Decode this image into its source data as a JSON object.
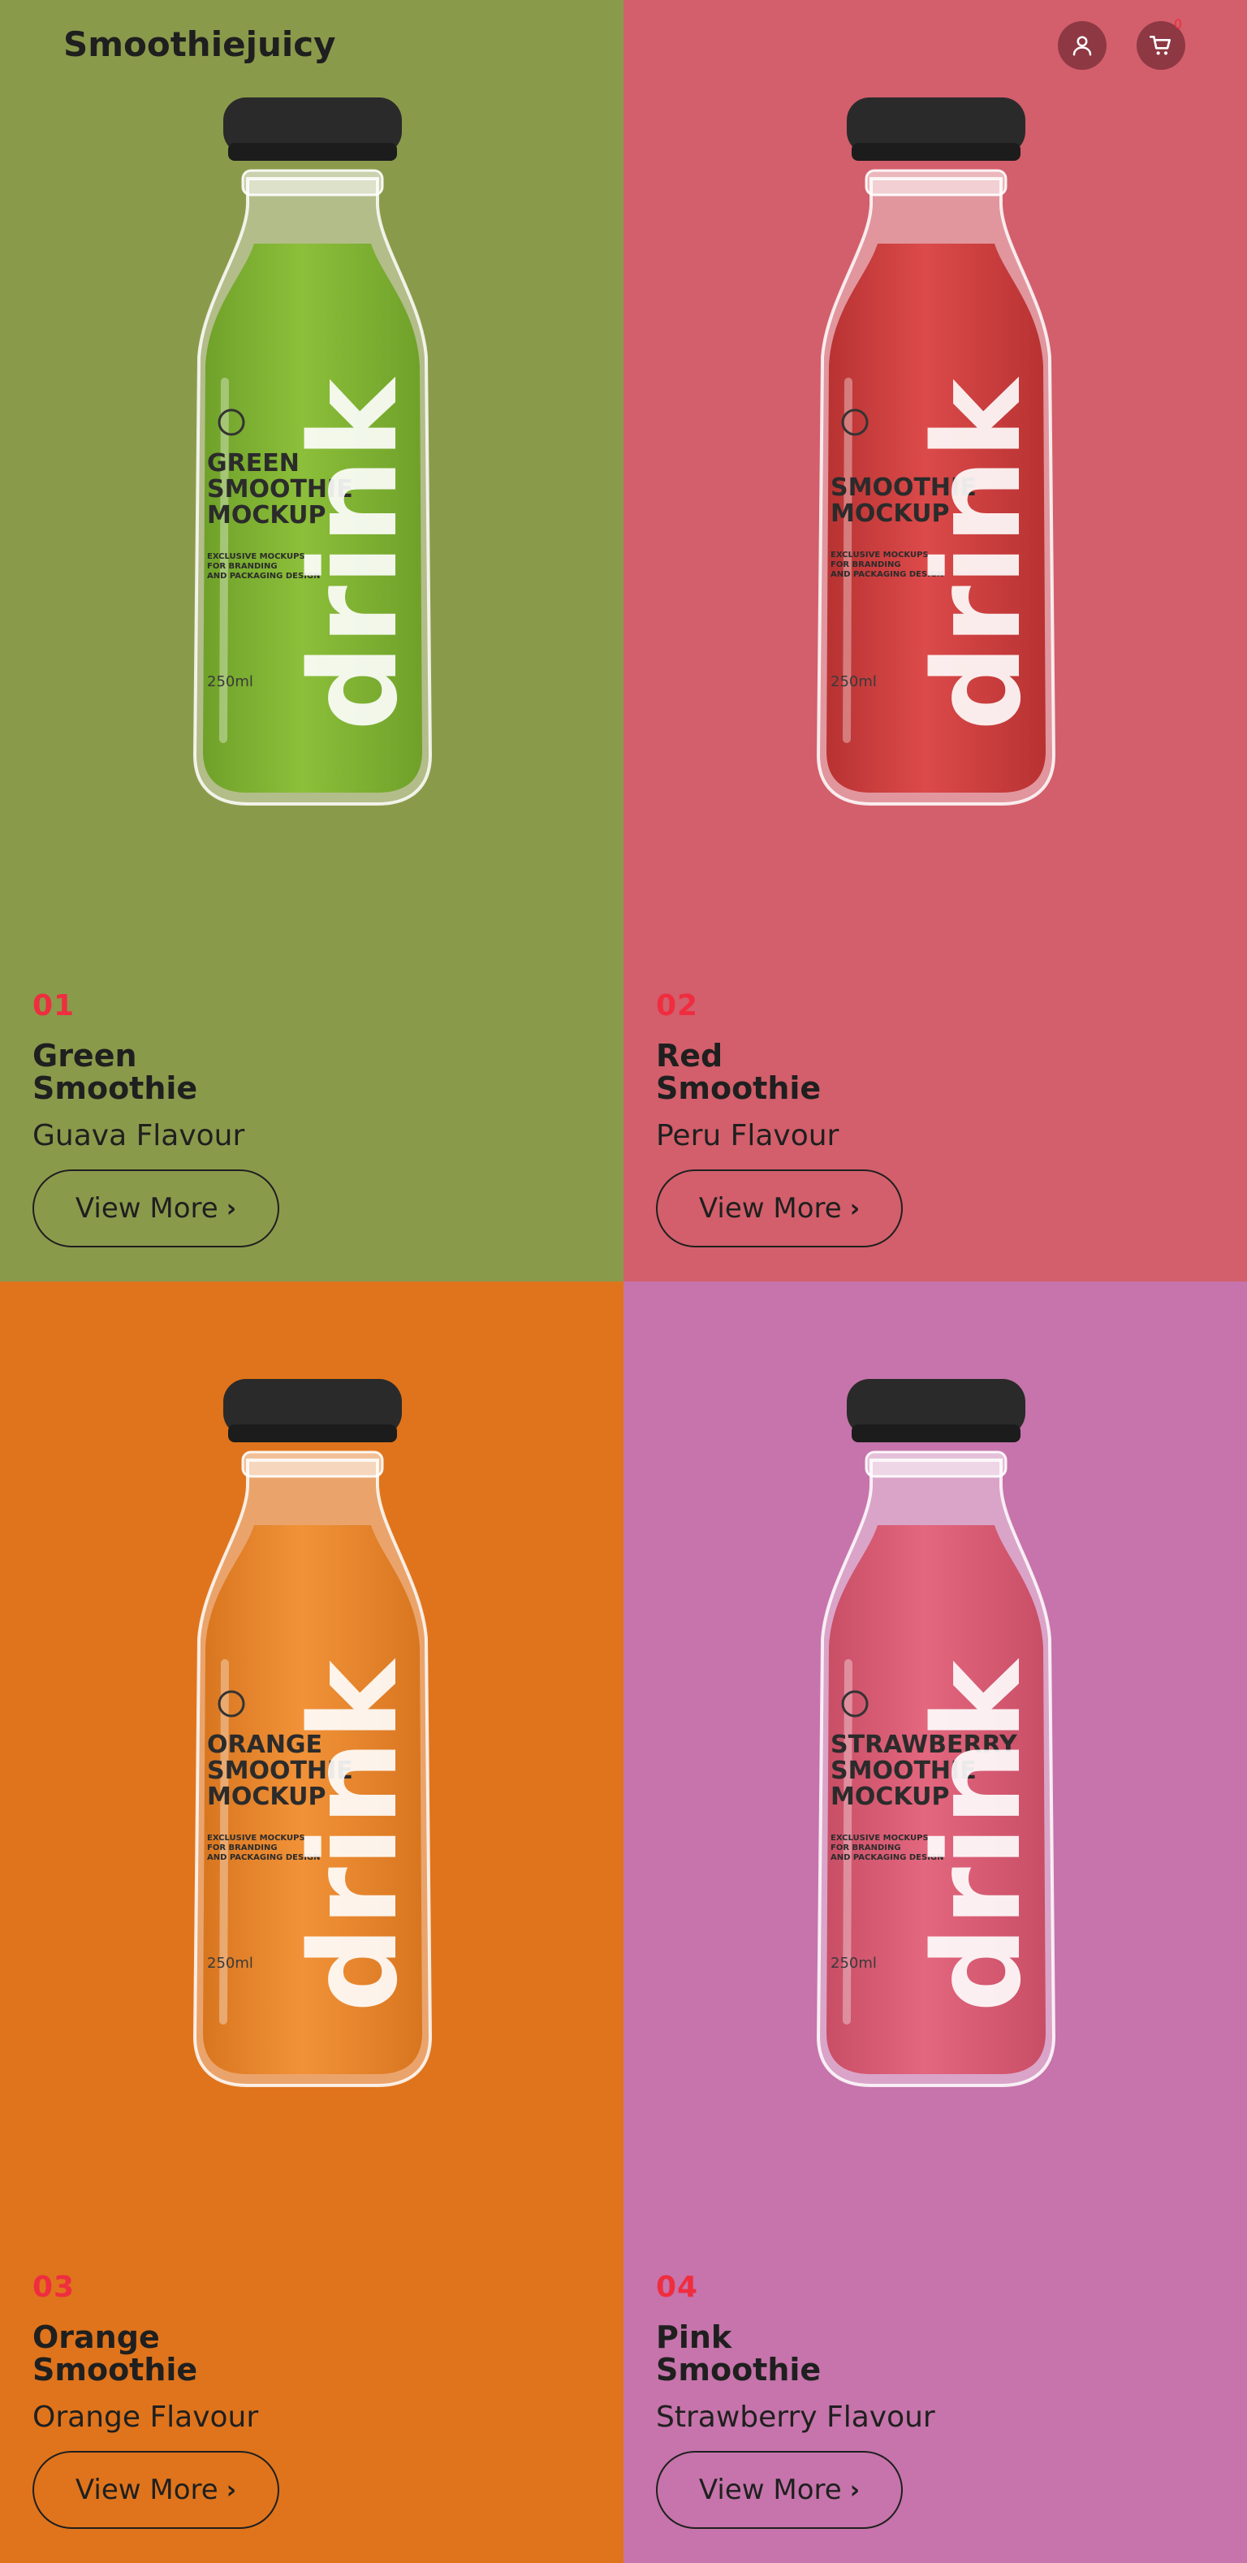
{
  "header": {
    "brand": "Smoothiejuicy",
    "user_icon": "user-icon",
    "cart_icon": "cart-icon",
    "cart_count": "0"
  },
  "products": [
    {
      "number": "01",
      "name_line1": "Green",
      "name_line2": "Smoothie",
      "flavour": "Guava Flavour",
      "button": "View More",
      "bg_color": "#8a9a4b",
      "juice_color": "#8cbf3a",
      "juice_dark": "#6fa12a",
      "label_lines": [
        "GREEN",
        "SMOOTHIE",
        "MOCKUP"
      ],
      "label_small": [
        "EXCLUSIVE MOCKUPS",
        "FOR BRANDING",
        "AND PACKAGING DESIGN"
      ],
      "volume": "250ml",
      "drink": "drink"
    },
    {
      "number": "02",
      "name_line1": "Red",
      "name_line2": "Smoothie",
      "flavour": "Peru Flavour",
      "button": "View More",
      "bg_color": "#d25f6b",
      "juice_color": "#dc4a4a",
      "juice_dark": "#b83232",
      "label_lines": [
        "SMOOTHIE",
        "MOCKUP"
      ],
      "label_small": [
        "EXCLUSIVE MOCKUPS",
        "FOR BRANDING",
        "AND PACKAGING DESIGN"
      ],
      "volume": "250ml",
      "drink": "drink"
    },
    {
      "number": "03",
      "name_line1": "Orange",
      "name_line2": "Smoothie",
      "flavour": "Orange Flavour",
      "button": "View More",
      "bg_color": "#df741c",
      "juice_color": "#f19238",
      "juice_dark": "#d87620",
      "label_lines": [
        "ORANGE",
        "SMOOTHIE",
        "MOCKUP"
      ],
      "label_small": [
        "EXCLUSIVE MOCKUPS",
        "FOR BRANDING",
        "AND PACKAGING DESIGN"
      ],
      "volume": "250ml",
      "drink": "drink"
    },
    {
      "number": "04",
      "name_line1": "Pink",
      "name_line2": "Smoothie",
      "flavour": "Strawberry Flavour",
      "button": "View More",
      "bg_color": "#c674ab",
      "juice_color": "#e3677e",
      "juice_dark": "#c84e66",
      "label_lines": [
        "STRAWBERRY",
        "SMOOTHIE",
        "MOCKUP"
      ],
      "label_small": [
        "EXCLUSIVE MOCKUPS",
        "FOR BRANDING",
        "AND PACKAGING DESIGN"
      ],
      "volume": "250ml",
      "drink": "drink"
    }
  ],
  "colors": {
    "text": "#1f1f1f",
    "accent_number": "#ef2d3f",
    "icon_bg": "#8e3844"
  }
}
